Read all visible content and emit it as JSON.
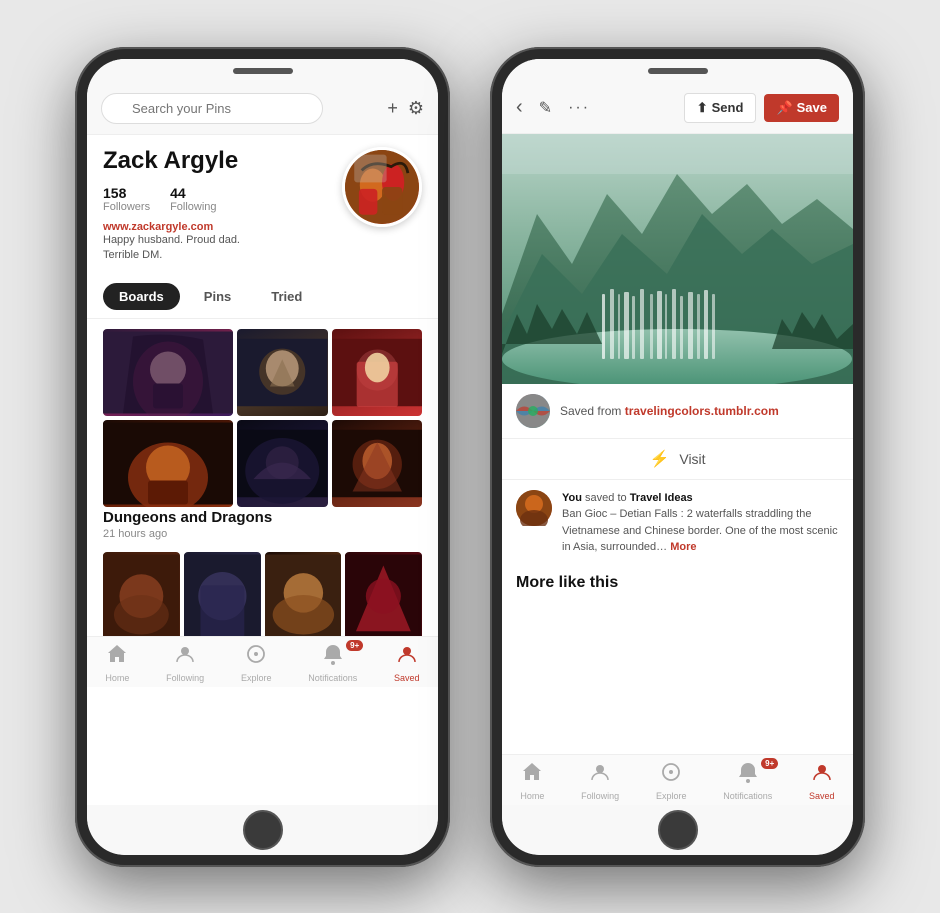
{
  "phone1": {
    "search_placeholder": "Search your Pins",
    "username": "Zack Argyle",
    "stats": {
      "followers_count": "158",
      "followers_label": "Followers",
      "following_count": "44",
      "following_label": "Following",
      "website": "www.zackargyle.com",
      "bio_line1": "Happy husband. Proud dad.",
      "bio_line2": "Terrible DM."
    },
    "tabs": [
      {
        "label": "Boards",
        "active": true
      },
      {
        "label": "Pins",
        "active": false
      },
      {
        "label": "Tried",
        "active": false
      }
    ],
    "board_title": "Dungeons and Dragons",
    "board_time": "21 hours ago",
    "nav": {
      "items": [
        {
          "label": "Home",
          "icon": "⊕"
        },
        {
          "label": "Following",
          "icon": "👤"
        },
        {
          "label": "Explore",
          "icon": "🔍"
        },
        {
          "label": "Notifications",
          "icon": "🔔",
          "badge": "9+"
        },
        {
          "label": "Saved",
          "icon": "👤",
          "active": true
        }
      ]
    }
  },
  "phone2": {
    "header": {
      "send_label": "Send",
      "save_label": "Save"
    },
    "source": {
      "saved_from": "Saved from",
      "source_link": "travelingcolors.tumblr.com"
    },
    "visit_label": "Visit",
    "saved": {
      "you": "You",
      "saved_to": "saved to",
      "board": "Travel Ideas",
      "description": "Ban Gioc – Detian Falls : 2 waterfalls straddling the Vietnamese and Chinese border. One of the most scenic in Asia, surrounded…",
      "more_label": "More"
    },
    "more_like_this": "More like this",
    "nav": {
      "items": [
        {
          "label": "Home",
          "icon": "⊕"
        },
        {
          "label": "Following",
          "icon": "👤"
        },
        {
          "label": "Explore",
          "icon": "🔍"
        },
        {
          "label": "Notifications",
          "icon": "🔔",
          "badge": "9+"
        },
        {
          "label": "Saved",
          "icon": "👤",
          "active": true
        }
      ]
    }
  }
}
